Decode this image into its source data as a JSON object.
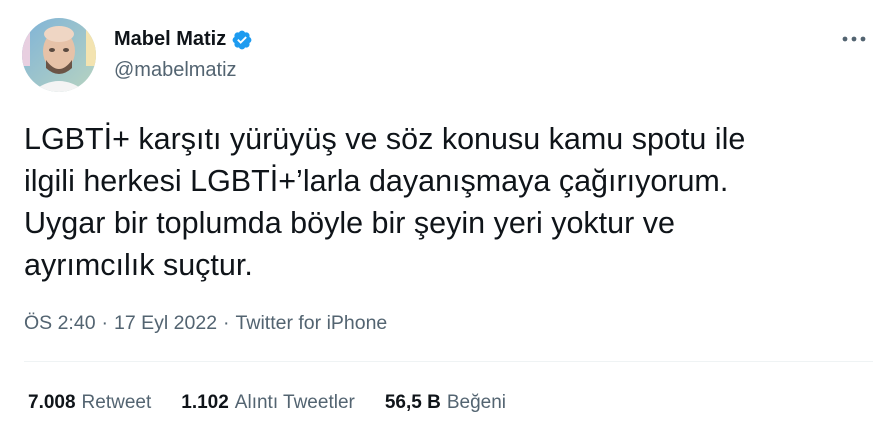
{
  "author": {
    "name": "Mabel Matiz",
    "handle": "@mabelmatiz",
    "verified_color": "#1d9bf0"
  },
  "more_icon": "more-horizontal-icon",
  "tweet": {
    "lines": [
      "LGBTİ+ karşıtı yürüyüş ve söz konusu kamu spotu ile",
      "ilgili herkesi LGBTİ+’larla dayanışmaya çağırıyorum.",
      "Uygar bir toplumda böyle bir şeyin yeri yoktur ve",
      "ayrımcılık suçtur."
    ]
  },
  "meta": {
    "time": "ÖS 2:40",
    "separator_1": "·",
    "date": "17 Eyl 2022",
    "separator_2": "·",
    "source": "Twitter for iPhone"
  },
  "stats": {
    "retweets": {
      "count": "7.008",
      "label": "Retweet"
    },
    "quotes": {
      "count": "1.102",
      "label": "Alıntı Tweetler"
    },
    "likes": {
      "count": "56,5 B",
      "label": "Beğeni"
    }
  },
  "colors": {
    "text": "#0f1419",
    "secondary": "#536471",
    "divider": "#eff3f4",
    "accent": "#1d9bf0"
  }
}
